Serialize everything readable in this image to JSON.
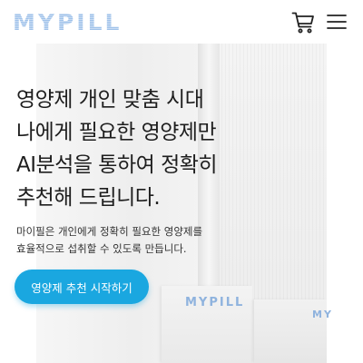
{
  "header": {
    "logo": "MYPILL",
    "cart_icon": "cart-icon",
    "menu_icon": "hamburger-menu-icon"
  },
  "hero": {
    "headline_lines": [
      "영양제 개인 맞춤 시대",
      "나에게 필요한 영양제만",
      "AI분석을 통하여 정확히",
      "추천해 드립니다."
    ],
    "sub_lines": [
      "마이필은 개인에게 정확히 필요한 영양제를",
      "효율적으로 섭취할 수 있도록 만듭니다."
    ],
    "cta_label": "영양제 추천 시작하기"
  },
  "product": {
    "box_logo_front": "MYPILL",
    "box_logo_right": "MY"
  },
  "colors": {
    "accent": "#1aa7e0",
    "logo": "#9fc2ea",
    "text": "#1e1e1e"
  }
}
